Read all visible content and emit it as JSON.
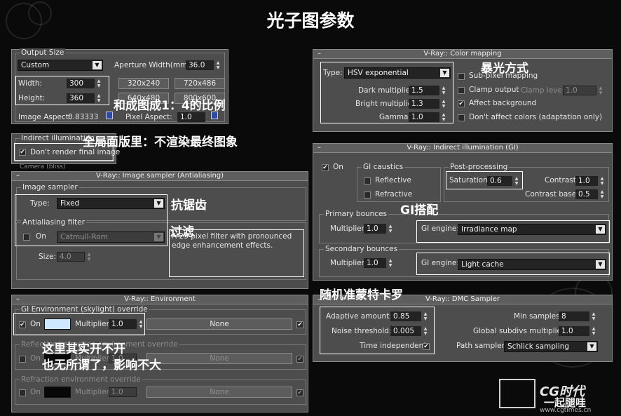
{
  "title": "光子图参数",
  "annotations": {
    "aspect": "和成图成1：4的比例",
    "gi": "全局面版里：不渲染最终图象",
    "exposure": "暴光方式",
    "antialias": "抗锯齿",
    "filter": "过滤",
    "gi_match": "GI搭配",
    "env1": "这里其实开不开",
    "env2": "也无所谓了，影响不大",
    "dmc": "随机准蒙特卡罗"
  },
  "output_size": {
    "title": "Output Size",
    "preset": "Custom",
    "aperture_label": "Aperture Width(mm):",
    "aperture_value": "36.0",
    "width_label": "Width:",
    "width_value": "300",
    "height_label": "Height:",
    "height_value": "360",
    "presets": [
      "320x240",
      "720x486",
      "640x480",
      "800x600"
    ],
    "image_aspect_label": "Image Aspect:",
    "image_aspect_value": "0.83333",
    "pixel_aspect_label": "Pixel Aspect:",
    "pixel_aspect_value": "1.0"
  },
  "indirect_illum": {
    "title": "Indirect illumination",
    "dont_render": "Don't render final image",
    "partial": "Camera (bliss)"
  },
  "image_sampler": {
    "header": "V-Ray:: Image sampler (Antialiasing)",
    "group_title": "Image sampler",
    "type_label": "Type:",
    "type_value": "Fixed",
    "aa_title": "Antialiasing filter",
    "on_label": "On",
    "filter_value": "Catmull-Rom",
    "desc": "A 25 pixel filter with pronounced edge enhancement effects.",
    "size_label": "Size:",
    "size_value": "4.0"
  },
  "environment": {
    "header": "V-Ray:: Environment",
    "gi_title": "GI Environment (skylight) override",
    "on_label": "On",
    "multiplier_label": "Multiplier:",
    "gi_multiplier": "1.0",
    "none_label": "None",
    "refl_title": "Reflection/refraction environment override",
    "refl_multiplier": "1.0",
    "refr_title": "Refraction environment override",
    "refr_multiplier": "1.0",
    "gi_color": "#cfe8ff"
  },
  "color_mapping": {
    "header": "V-Ray:: Color mapping",
    "type_label": "Type:",
    "type_value": "HSV exponential",
    "dark_label": "Dark multiplier:",
    "dark_value": "1.5",
    "bright_label": "Bright multiplier:",
    "bright_value": "1.3",
    "gamma_label": "Gamma:",
    "gamma_value": "1.0",
    "subpixel": "Sub-pixel mapping",
    "clamp": "Clamp output",
    "clamp_level_label": "Clamp level:",
    "clamp_level_value": "1.0",
    "affect_bg": "Affect background",
    "dont_affect": "Don't affect colors (adaptation only)"
  },
  "indirect_gi": {
    "header": "V-Ray:: Indirect illumination (GI)",
    "on_label": "On",
    "caustics_title": "GI caustics",
    "reflective": "Reflective",
    "refractive": "Refractive",
    "post_title": "Post-processing",
    "saturation_label": "Saturation:",
    "saturation_value": "0.6",
    "contrast_label": "Contrast:",
    "contrast_value": "1.0",
    "contrast_base_label": "Contrast base:",
    "contrast_base_value": "0.5",
    "primary_title": "Primary bounces",
    "multiplier_label": "Multiplier:",
    "primary_multiplier": "1.0",
    "engine_label": "GI engine:",
    "primary_engine": "Irradiance map",
    "secondary_title": "Secondary bounces",
    "secondary_multiplier": "1.0",
    "secondary_engine": "Light cache"
  },
  "dmc": {
    "header": "V-Ray:: DMC Sampler",
    "adaptive_label": "Adaptive amount:",
    "adaptive_value": "0.85",
    "noise_label": "Noise threshold:",
    "noise_value": "0.005",
    "time_label": "Time independent",
    "min_samples_label": "Min samples:",
    "min_samples_value": "8",
    "subdivs_label": "Global subdivs multiplier:",
    "subdivs_value": "1.0",
    "path_label": "Path sampler:",
    "path_value": "Schlick sampling"
  },
  "watermark": {
    "logo": "CG时代",
    "slogan": "一起腿哇",
    "url": "www.cgtimes.cn"
  }
}
